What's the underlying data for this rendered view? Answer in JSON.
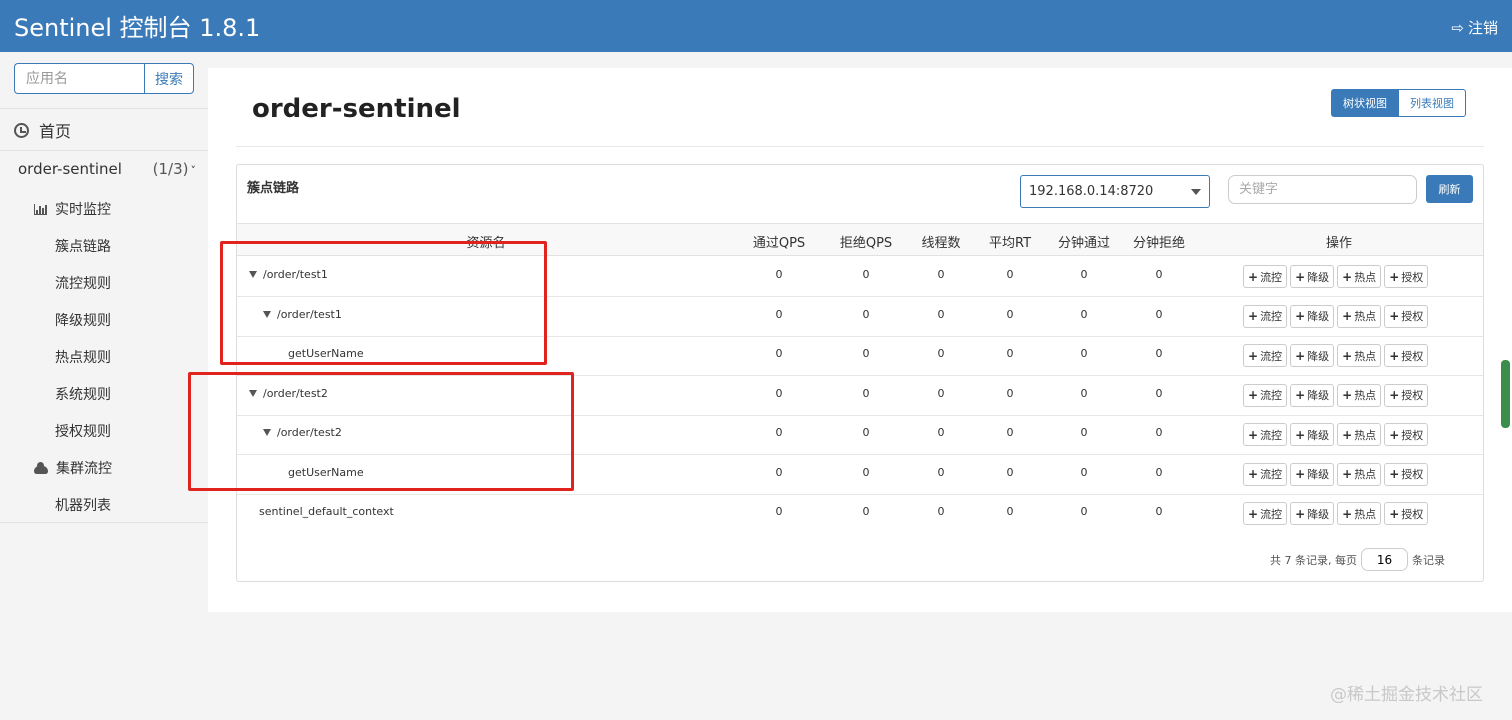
{
  "header": {
    "title": "Sentinel 控制台 1.8.1",
    "logout_label": "注销",
    "logout_icon": "logout-icon"
  },
  "sidebar": {
    "search_placeholder": "应用名",
    "search_button": "搜索",
    "home_label": "首页",
    "app_name": "order-sentinel",
    "app_count": "(1/3)",
    "monitor_label": "实时监控",
    "items": [
      "簇点链路",
      "流控规则",
      "降级规则",
      "热点规则",
      "系统规则",
      "授权规则"
    ],
    "cluster_label": "集群流控",
    "machines_label": "机器列表"
  },
  "main": {
    "title": "order-sentinel",
    "view_tree": "树状视图",
    "view_list": "列表视图"
  },
  "panel": {
    "title": "簇点链路",
    "selected_ip": "192.168.0.14:8720",
    "keyword_placeholder": "关键字",
    "refresh": "刷新",
    "columns": [
      "资源名",
      "通过QPS",
      "拒绝QPS",
      "线程数",
      "平均RT",
      "分钟通过",
      "分钟拒绝",
      "操作"
    ],
    "rows": [
      {
        "name": "/order/test1",
        "level": 0,
        "expanded": true,
        "values": [
          "0",
          "0",
          "0",
          "0",
          "0",
          "0"
        ]
      },
      {
        "name": "/order/test1",
        "level": 1,
        "expanded": true,
        "values": [
          "0",
          "0",
          "0",
          "0",
          "0",
          "0"
        ]
      },
      {
        "name": "getUserName",
        "level": 2,
        "expanded": false,
        "values": [
          "0",
          "0",
          "0",
          "0",
          "0",
          "0"
        ]
      },
      {
        "name": "/order/test2",
        "level": 0,
        "expanded": true,
        "values": [
          "0",
          "0",
          "0",
          "0",
          "0",
          "0"
        ]
      },
      {
        "name": "/order/test2",
        "level": 1,
        "expanded": true,
        "values": [
          "0",
          "0",
          "0",
          "0",
          "0",
          "0"
        ]
      },
      {
        "name": "getUserName",
        "level": 2,
        "expanded": false,
        "values": [
          "0",
          "0",
          "0",
          "0",
          "0",
          "0"
        ]
      },
      {
        "name": "sentinel_default_context",
        "level": -1,
        "expanded": false,
        "values": [
          "0",
          "0",
          "0",
          "0",
          "0",
          "0"
        ]
      }
    ],
    "actions": [
      "流控",
      "降级",
      "热点",
      "授权"
    ],
    "pager_prefix": "共 7 条记录, 每页",
    "page_size": "16",
    "pager_suffix": "条记录"
  },
  "watermark": "@稀土掘金技术社区",
  "colors": {
    "primary": "#3a7ab8",
    "highlight_box": "#e0231c"
  }
}
